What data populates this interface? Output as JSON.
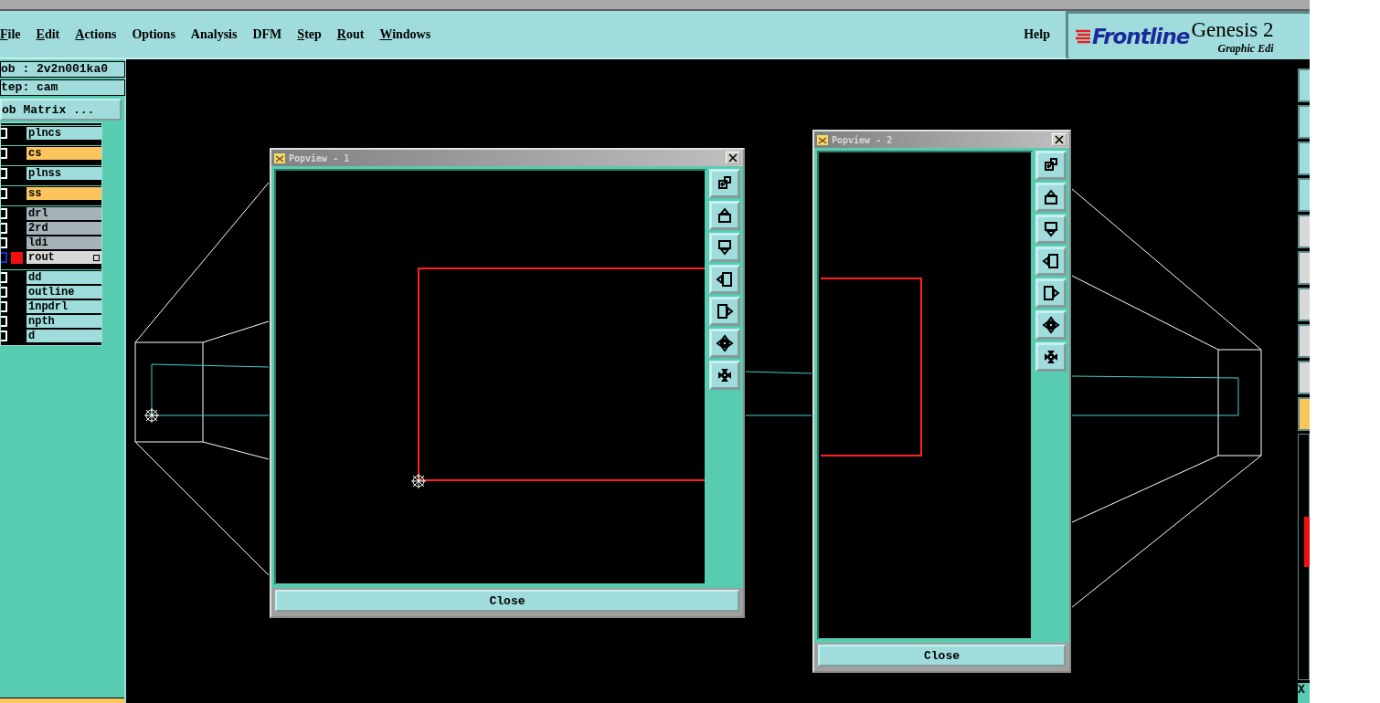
{
  "menu": [
    {
      "label": "File",
      "mnemonic": true
    },
    {
      "label": "Edit",
      "mnemonic": true
    },
    {
      "label": "Actions",
      "mnemonic": true
    },
    {
      "label": "Options",
      "mnemonic": false
    },
    {
      "label": "Analysis",
      "mnemonic": false
    },
    {
      "label": "DFM",
      "mnemonic": false
    },
    {
      "label": "Step",
      "mnemonic": true
    },
    {
      "label": "Rout",
      "mnemonic": true
    },
    {
      "label": "Windows",
      "mnemonic": true
    }
  ],
  "help": "Help",
  "logo": {
    "brand": "Frontline",
    "product": "Genesis 2",
    "subtitle": "Graphic Edi"
  },
  "job": "ob : 2v2n001ka0",
  "step": "tep: cam",
  "job_matrix_button": "ob Matrix ...",
  "layer_groups": [
    [
      {
        "name": "plncs",
        "color": "#9fdcdc",
        "selected": false
      }
    ],
    [
      {
        "name": "cs",
        "color": "#fcc45c",
        "selected": false
      }
    ],
    [
      {
        "name": "plnss",
        "color": "#9fdcdc",
        "selected": false
      }
    ],
    [
      {
        "name": "ss",
        "color": "#fcc45c",
        "selected": false
      }
    ],
    [
      {
        "name": "drl",
        "color": "#a3b3b8",
        "selected": false
      },
      {
        "name": "2rd",
        "color": "#a3b3b8",
        "selected": false
      },
      {
        "name": "ldi",
        "color": "#a3b3b8",
        "selected": false
      },
      {
        "name": "rout",
        "color": "#d8d8d8",
        "selected": true
      }
    ],
    [
      {
        "name": "dd",
        "color": "#9fdcdc",
        "selected": false
      },
      {
        "name": "outline",
        "color": "#9fdcdc",
        "selected": false
      },
      {
        "name": "1npdrl",
        "color": "#9fdcdc",
        "selected": false
      },
      {
        "name": "npth",
        "color": "#9fdcdc",
        "selected": false
      },
      {
        "name": "d",
        "color": "#9fdcdc",
        "selected": false
      }
    ]
  ],
  "popviews": [
    {
      "title": "Popview - 1",
      "close_button": "Close",
      "tools": [
        {
          "kind": "swap"
        },
        {
          "kind": "up"
        },
        {
          "kind": "down"
        },
        {
          "kind": "left"
        },
        {
          "kind": "right"
        },
        {
          "kind": "zoom-in"
        },
        {
          "kind": "zoom-out"
        }
      ]
    },
    {
      "title": "Popview - 2",
      "close_button": "Close",
      "tools": [
        {
          "kind": "swap"
        },
        {
          "kind": "up"
        },
        {
          "kind": "down"
        },
        {
          "kind": "left"
        },
        {
          "kind": "right"
        },
        {
          "kind": "zoom-in"
        },
        {
          "kind": "zoom-out"
        }
      ]
    }
  ],
  "coord_label": "X"
}
